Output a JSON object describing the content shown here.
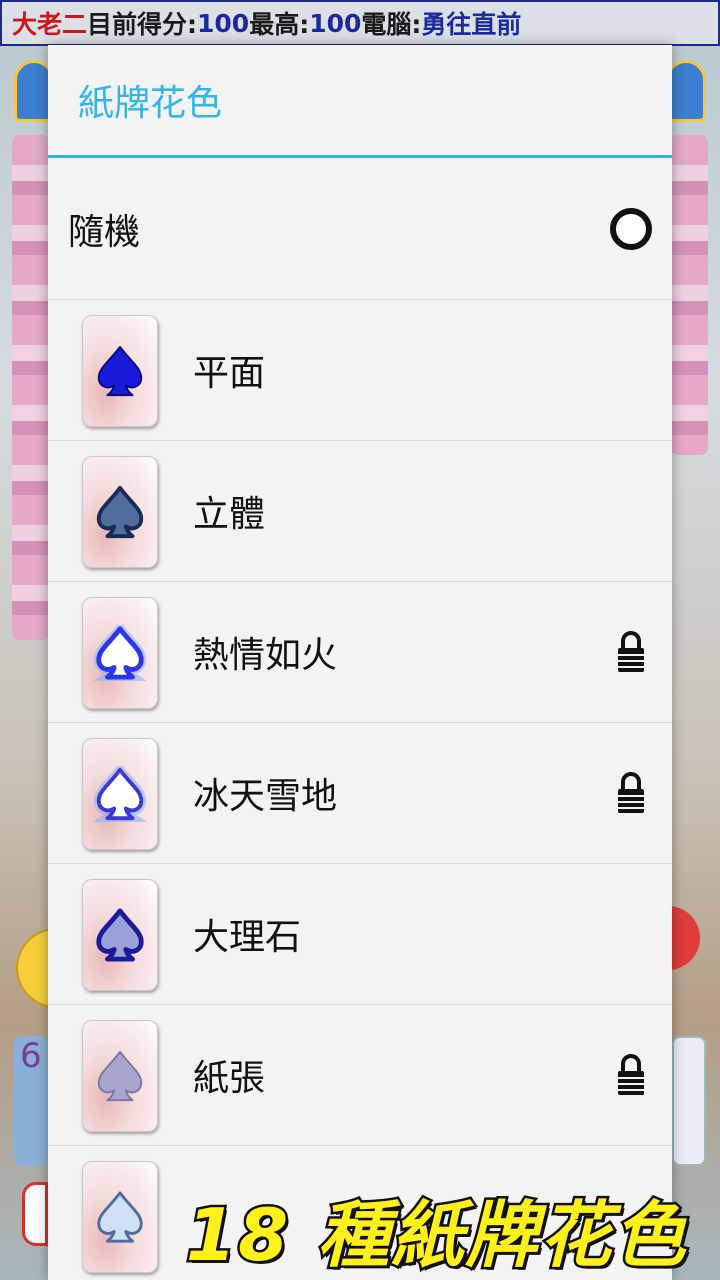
{
  "status_bar": {
    "player": "大老二",
    "score_label": " 目前得分:",
    "score": "100",
    "best_label": " 最高:",
    "best": "100",
    "computer_label": " 電腦:",
    "computer": "勇往直前"
  },
  "dialog": {
    "title": "紙牌花色",
    "random_label": "隨機",
    "items": [
      {
        "label": "平面",
        "locked": false,
        "icon": "spade-flat-icon"
      },
      {
        "label": "立體",
        "locked": false,
        "icon": "spade-3d-icon"
      },
      {
        "label": "熱情如火",
        "locked": true,
        "icon": "spade-fire-icon"
      },
      {
        "label": "冰天雪地",
        "locked": true,
        "icon": "spade-ice-icon"
      },
      {
        "label": "大理石",
        "locked": false,
        "icon": "spade-marble-icon"
      },
      {
        "label": "紙張",
        "locked": true,
        "icon": "spade-paper-icon"
      },
      {
        "label": "",
        "locked": false,
        "icon": "spade-light-icon"
      }
    ]
  },
  "promo_text": "18 種紙牌花色",
  "colors": {
    "accent": "#33b5e5",
    "status_red": "#c81818",
    "status_blue": "#1c2aa0",
    "promo_yellow": "#ffef1a"
  }
}
